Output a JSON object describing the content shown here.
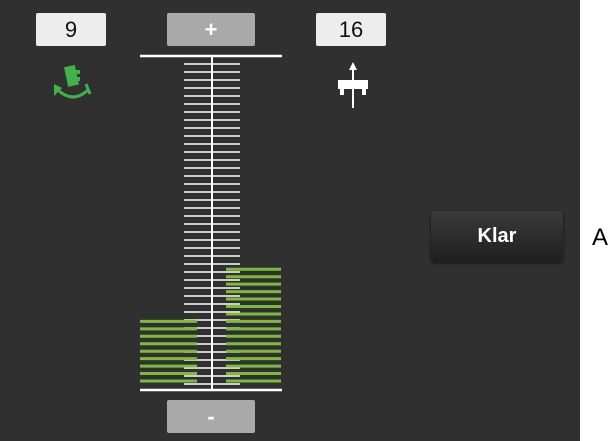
{
  "left_value": "9",
  "right_value": "16",
  "plus_label": "+",
  "minus_label": "-",
  "klar_label": "Klar",
  "side_label": "A",
  "left_icon": "rotate-seat-icon",
  "right_icon": "vertical-adjust-icon",
  "left_level": {
    "filled": 9,
    "total": 16
  },
  "right_level": {
    "filled": 16,
    "total": 16
  },
  "colors": {
    "panel": "#303030",
    "accent_green": "#7dbb3f",
    "icon_green": "#3fb34a",
    "tick": "#ffffff"
  }
}
